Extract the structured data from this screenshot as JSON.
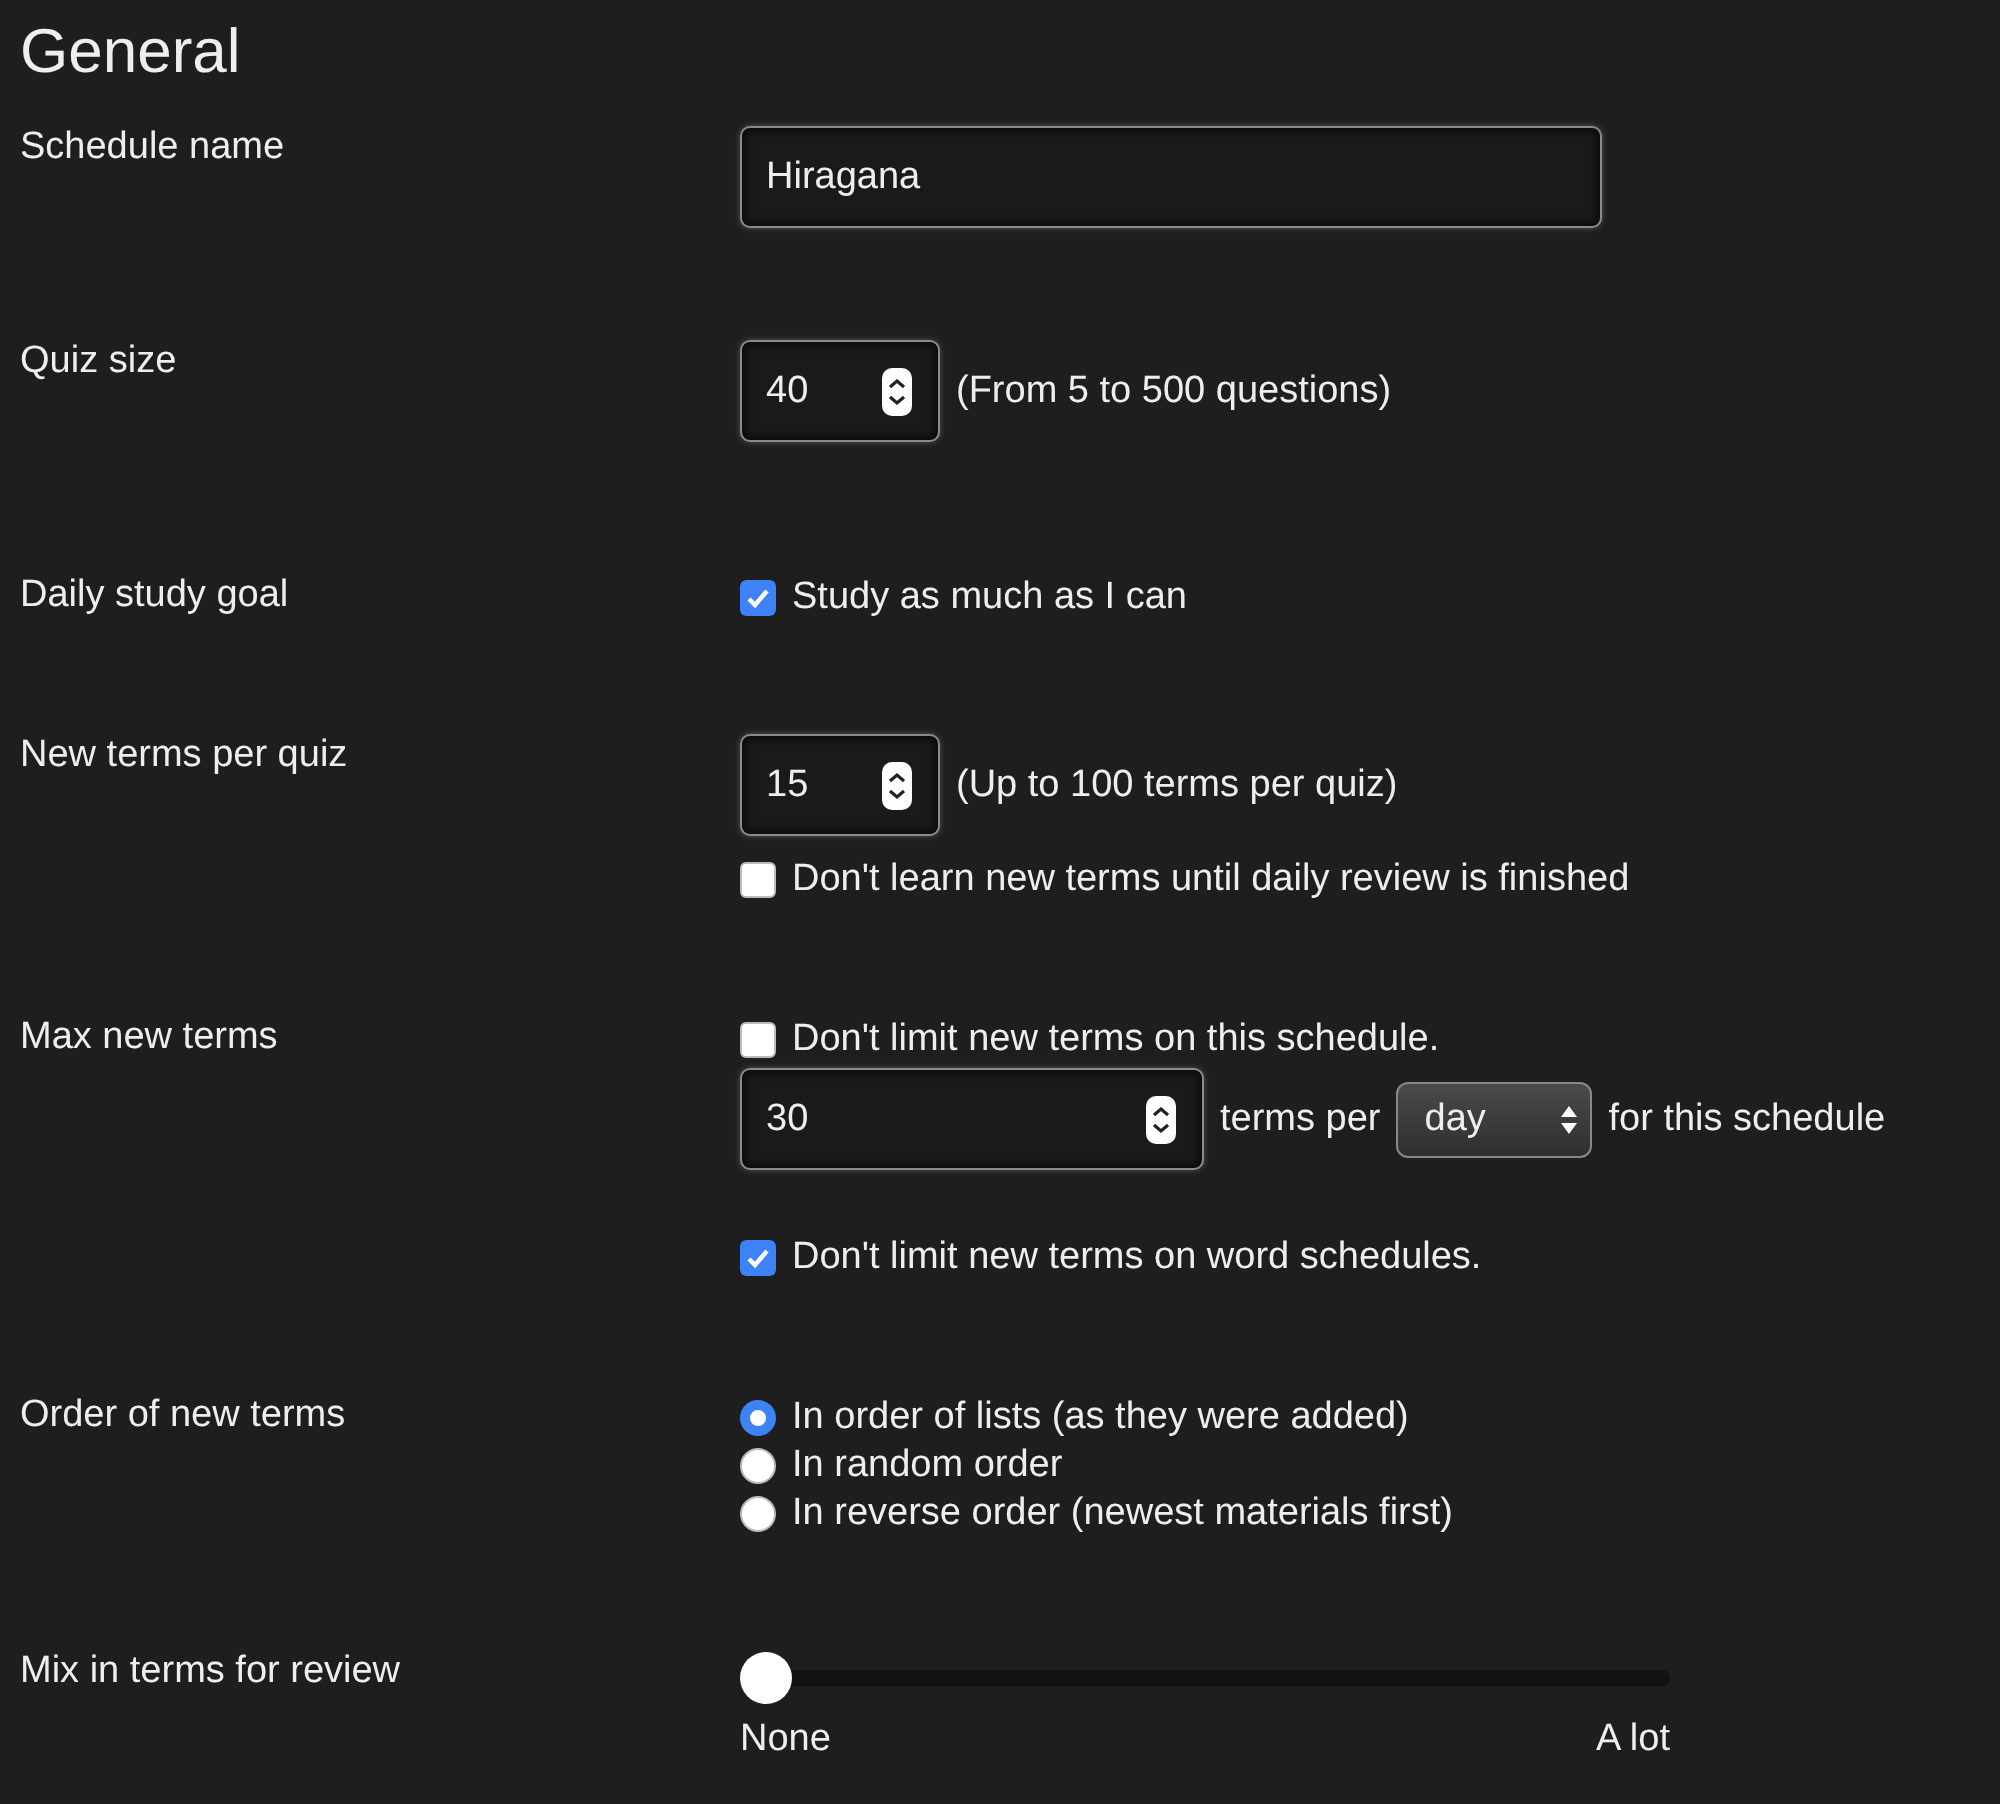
{
  "heading": "General",
  "settings": [
    {
      "label": "Schedule name",
      "controls": [
        {
          "kind": "text",
          "value": "Hiragana"
        }
      ]
    },
    {
      "label": "Quiz size",
      "controls": [
        {
          "kind": "number",
          "value": "40",
          "note": "(From 5 to 500 questions)"
        }
      ]
    },
    {
      "label": "Daily study goal",
      "controls": [
        {
          "kind": "checkbox",
          "checked": true,
          "text": "Study as much as I can"
        }
      ]
    },
    {
      "label": "New terms per quiz",
      "controls": [
        {
          "kind": "number",
          "value": "15",
          "note": "(Up to 100 terms per quiz)"
        },
        {
          "kind": "checkbox",
          "checked": false,
          "text": "Don't learn new terms until daily review is finished"
        }
      ]
    },
    {
      "label": "Max new terms",
      "controls": [
        {
          "kind": "checkbox",
          "checked": false,
          "text": "Don't limit new terms on this schedule."
        },
        {
          "kind": "limit",
          "value": "30",
          "before": "terms per",
          "select": "day",
          "after": "for this schedule"
        },
        {
          "kind": "checkbox",
          "checked": true,
          "text": "Don't limit new terms on word schedules."
        }
      ]
    },
    {
      "label": "Order of new terms",
      "controls": [
        {
          "kind": "radios",
          "options": [
            {
              "text": "In order of lists (as they were added)",
              "selected": true
            },
            {
              "text": "In random order",
              "selected": false
            },
            {
              "text": "In reverse order (newest materials first)",
              "selected": false
            }
          ]
        }
      ]
    },
    {
      "label": "Mix in terms for review",
      "controls": [
        {
          "kind": "slider",
          "level": 0,
          "min_label": "None",
          "max_label": "A lot"
        }
      ]
    }
  ]
}
